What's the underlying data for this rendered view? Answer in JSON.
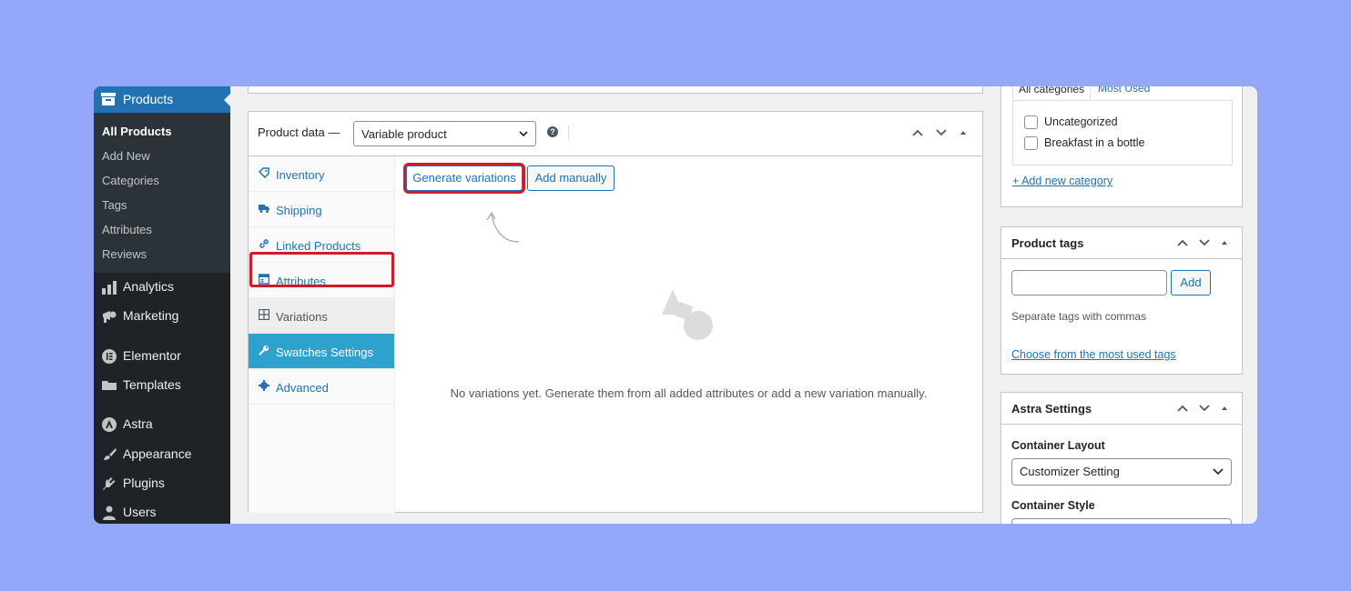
{
  "sidebar": {
    "active_menu": "Products",
    "submenu": [
      "All Products",
      "Add New",
      "Categories",
      "Tags",
      "Attributes",
      "Reviews"
    ],
    "items": [
      "Analytics",
      "Marketing",
      "Elementor",
      "Templates",
      "Astra",
      "Appearance",
      "Plugins",
      "Users"
    ]
  },
  "product_data": {
    "title": "Product data —",
    "type_value": "Variable product",
    "help_icon": "?",
    "tabs": [
      "Inventory",
      "Shipping",
      "Linked Products",
      "Attributes",
      "Variations",
      "Swatches Settings",
      "Advanced"
    ],
    "active_tab": "Variations",
    "buttons": {
      "generate": "Generate variations",
      "add_manually": "Add manually"
    },
    "empty_message": "No variations yet. Generate them from all added attributes or add a new variation manually."
  },
  "categories": {
    "tabs": [
      "All categories",
      "Most Used"
    ],
    "items": [
      "Uncategorized",
      "Breakfast in a bottle"
    ],
    "add_link": "+ Add new category"
  },
  "product_tags": {
    "title": "Product tags",
    "add_button": "Add",
    "hint": "Separate tags with commas",
    "choose_link": "Choose from the most used tags"
  },
  "astra_settings": {
    "title": "Astra Settings",
    "container_layout_label": "Container Layout",
    "container_layout_value": "Customizer Setting",
    "container_style_label": "Container Style"
  },
  "colors": {
    "background": "#94a7f9",
    "admin_sidebar": "#1d2327",
    "accent_blue": "#2271b1",
    "swatches_tab": "#2ea2cc",
    "highlight_red": "#d11a2a"
  }
}
